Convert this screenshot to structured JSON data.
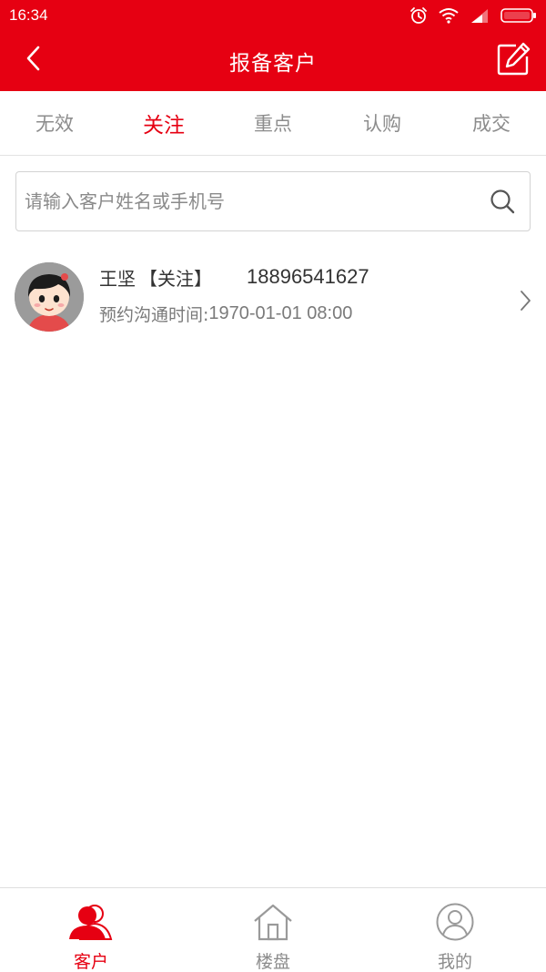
{
  "status_bar": {
    "time": "16:34",
    "icons": [
      "alarm-icon",
      "wifi-icon",
      "signal-icon",
      "battery-icon"
    ]
  },
  "header": {
    "title": "报备客户",
    "back_icon": "chevron-left-icon",
    "edit_icon": "edit-icon"
  },
  "tabs": [
    {
      "label": "无效",
      "active": false
    },
    {
      "label": "关注",
      "active": true
    },
    {
      "label": "重点",
      "active": false
    },
    {
      "label": "认购",
      "active": false
    },
    {
      "label": "成交",
      "active": false
    }
  ],
  "search": {
    "placeholder": "请输入客户姓名或手机号",
    "value": "",
    "icon": "search-icon"
  },
  "customers": [
    {
      "name": "王坚",
      "status": "【关注】",
      "phone": "18896541627",
      "appointment_label": "预约沟通时间:",
      "appointment_time": "1970-01-01 08:00"
    }
  ],
  "bottom_nav": [
    {
      "label": "客户",
      "icon": "customers-icon",
      "active": true
    },
    {
      "label": "楼盘",
      "icon": "house-icon",
      "active": false
    },
    {
      "label": "我的",
      "icon": "user-icon",
      "active": false
    }
  ],
  "colors": {
    "accent": "#e60012",
    "text_primary": "#333333",
    "text_secondary": "#8c8c8c"
  }
}
